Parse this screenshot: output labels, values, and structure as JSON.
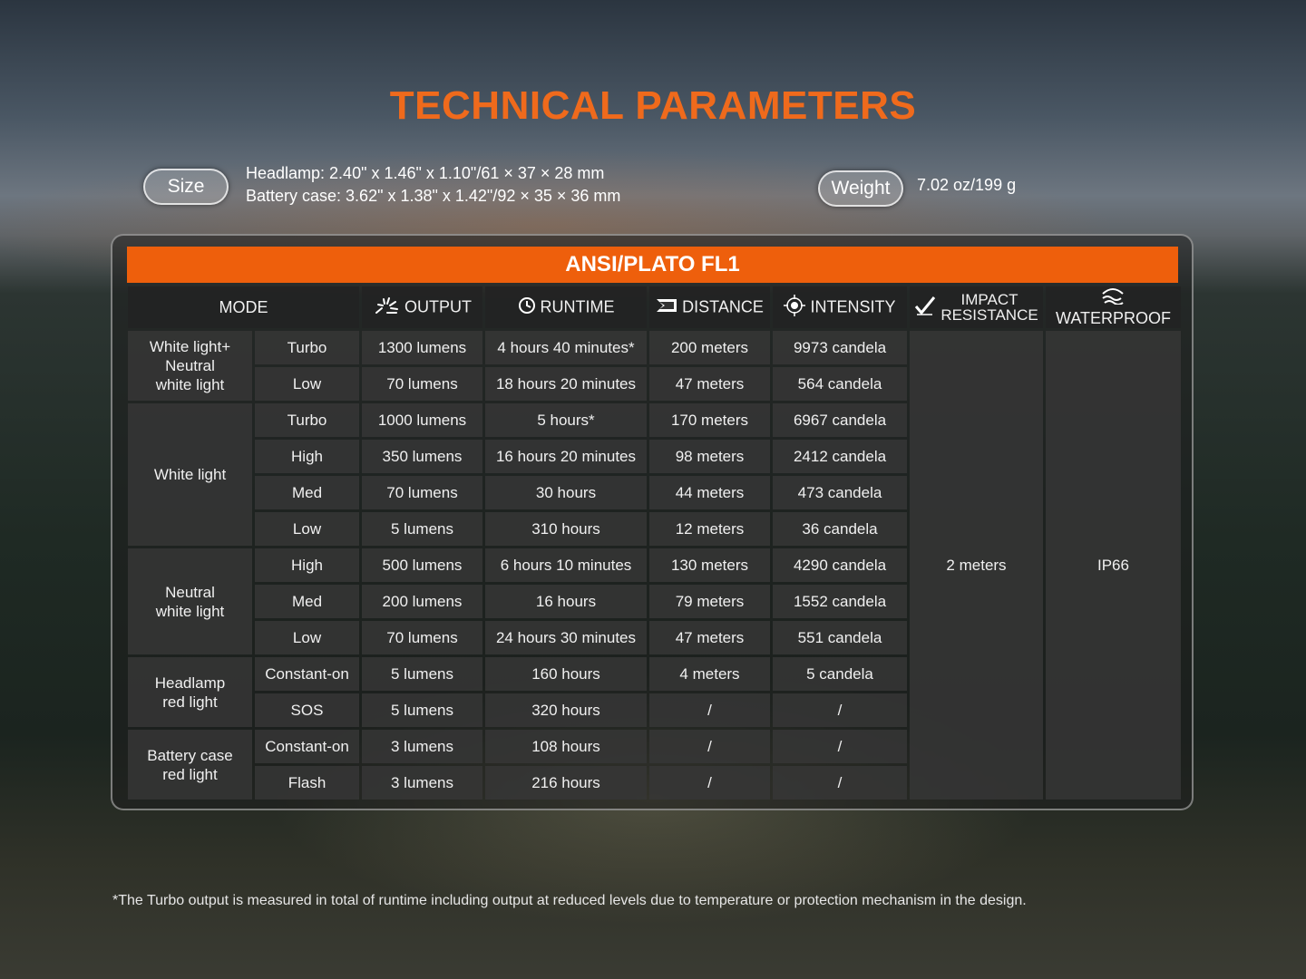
{
  "title": "TECHNICAL PARAMETERS",
  "size": {
    "label": "Size",
    "headlamp": "Headlamp: 2.40\" x 1.46\" x 1.10\"/61 × 37 × 28 mm",
    "battery_case": "Battery case: 3.62\" x 1.38\" x 1.42\"/92 × 35 × 36 mm"
  },
  "weight": {
    "label": "Weight",
    "value": "7.02 oz/199 g"
  },
  "banner": "ANSI/PLATO FL1",
  "headers": {
    "mode": "MODE",
    "output": "OUTPUT",
    "runtime": "RUNTIME",
    "distance": "DISTANCE",
    "intensity": "INTENSITY",
    "impact_line1": "IMPACT",
    "impact_line2": "RESISTANCE",
    "waterproof": "WATERPROOF"
  },
  "icons": {
    "output": "burst-icon",
    "runtime": "clock-icon",
    "distance": "beam-icon",
    "intensity": "crosshair-icon",
    "impact": "drop-check-icon",
    "waterproof": "water-wave-icon"
  },
  "groups": [
    {
      "label": "White light+ Neutral white light",
      "label_lines": [
        "White light+",
        "Neutral",
        "white light"
      ],
      "rows": [
        {
          "mode": "Turbo",
          "output": "1300 lumens",
          "runtime": "4 hours 40 minutes*",
          "distance": "200 meters",
          "intensity": "9973 candela"
        },
        {
          "mode": "Low",
          "output": "70 lumens",
          "runtime": "18 hours 20 minutes",
          "distance": "47 meters",
          "intensity": "564 candela"
        }
      ]
    },
    {
      "label": "White light",
      "label_lines": [
        "White light"
      ],
      "rows": [
        {
          "mode": "Turbo",
          "output": "1000 lumens",
          "runtime": "5 hours*",
          "distance": "170 meters",
          "intensity": "6967 candela"
        },
        {
          "mode": "High",
          "output": "350 lumens",
          "runtime": "16 hours 20 minutes",
          "distance": "98 meters",
          "intensity": "2412 candela"
        },
        {
          "mode": "Med",
          "output": "70 lumens",
          "runtime": "30 hours",
          "distance": "44 meters",
          "intensity": "473 candela"
        },
        {
          "mode": "Low",
          "output": "5 lumens",
          "runtime": "310 hours",
          "distance": "12 meters",
          "intensity": "36 candela"
        }
      ]
    },
    {
      "label": "Neutral white light",
      "label_lines": [
        "Neutral",
        "white light"
      ],
      "rows": [
        {
          "mode": "High",
          "output": "500 lumens",
          "runtime": "6 hours 10 minutes",
          "distance": "130 meters",
          "intensity": "4290 candela"
        },
        {
          "mode": "Med",
          "output": "200 lumens",
          "runtime": "16 hours",
          "distance": "79 meters",
          "intensity": "1552 candela"
        },
        {
          "mode": "Low",
          "output": "70 lumens",
          "runtime": "24 hours 30 minutes",
          "distance": "47 meters",
          "intensity": "551 candela"
        }
      ]
    },
    {
      "label": "Headlamp red light",
      "label_lines": [
        "Headlamp",
        "red light"
      ],
      "rows": [
        {
          "mode": "Constant-on",
          "output": "5 lumens",
          "runtime": "160 hours",
          "distance": "4 meters",
          "intensity": "5 candela"
        },
        {
          "mode": "SOS",
          "output": "5 lumens",
          "runtime": "320 hours",
          "distance": "/",
          "intensity": "/"
        }
      ]
    },
    {
      "label": "Battery case red light",
      "label_lines": [
        "Battery case",
        "red light"
      ],
      "rows": [
        {
          "mode": "Constant-on",
          "output": "3 lumens",
          "runtime": "108 hours",
          "distance": "/",
          "intensity": "/"
        },
        {
          "mode": "Flash",
          "output": "3 lumens",
          "runtime": "216 hours",
          "distance": "/",
          "intensity": "/"
        }
      ]
    }
  ],
  "impact_resistance": "2 meters",
  "waterproof": "IP66",
  "footnote": "*The Turbo output is measured in total of runtime including output at reduced levels due to temperature or protection mechanism in the design.",
  "colors": {
    "accent": "#ee5f0c",
    "title": "#ef6a1c",
    "cell": "#373737",
    "text": "#f0f0f0"
  }
}
